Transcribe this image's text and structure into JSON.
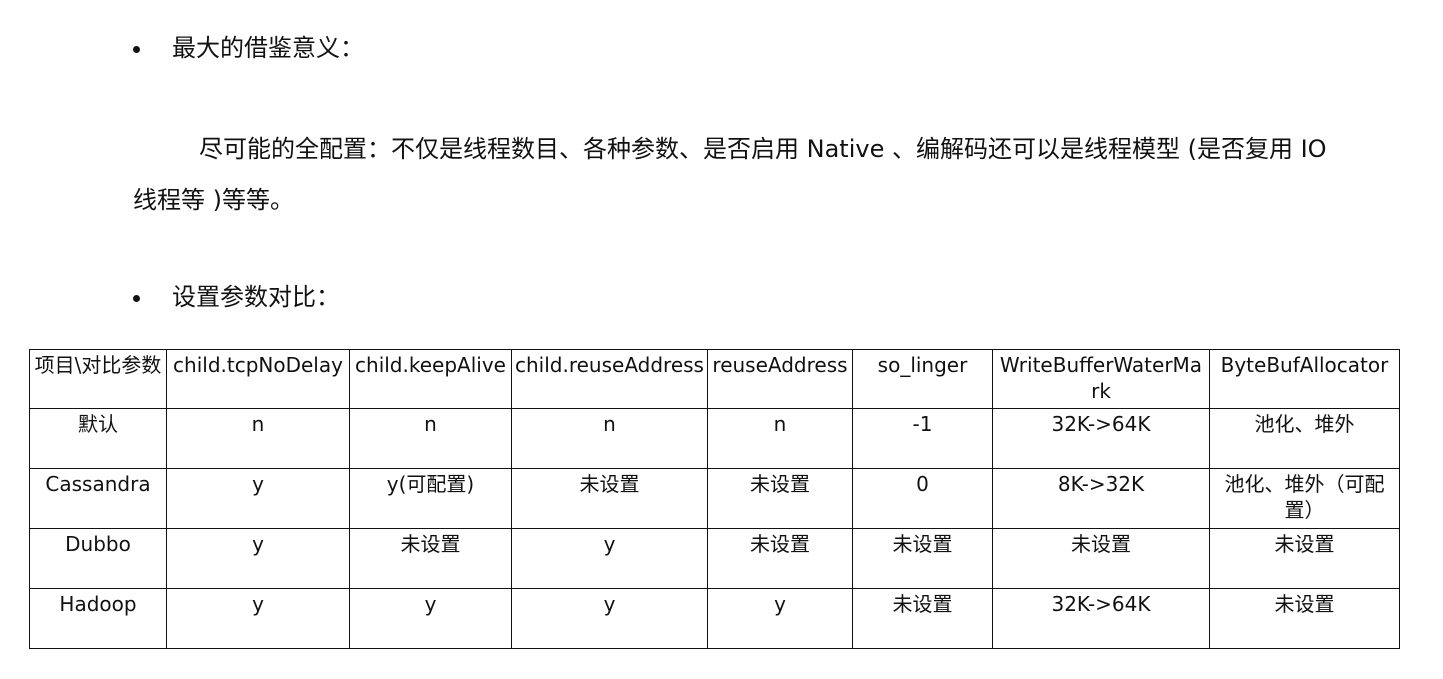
{
  "bullets": [
    "最大的借鉴意义：",
    "设置参数对比："
  ],
  "paragraph": "尽可能的全配置：不仅是线程数目、各种参数、是否启用 Native 、编解码还可以是线程模型 (是否复用 IO 线程等 )等等。",
  "table": {
    "headers": [
      "项目\\对比参数",
      "child.tcpNoDelay",
      "child.keepAlive",
      "child.reuseAddress",
      "reuseAddress",
      "so_linger",
      "WriteBufferWaterMark",
      "ByteBufAllocator"
    ],
    "rows": [
      [
        "默认",
        "n",
        "n",
        "n",
        "n",
        "-1",
        "32K->64K",
        "池化、堆外"
      ],
      [
        "Cassandra",
        "y",
        "y(可配置)",
        "未设置",
        "未设置",
        "0",
        "8K->32K",
        "池化、堆外（可配置）"
      ],
      [
        "Dubbo",
        "y",
        "未设置",
        "y",
        "未设置",
        "未设置",
        "未设置",
        "未设置"
      ],
      [
        "Hadoop",
        "y",
        "y",
        "y",
        "y",
        "未设置",
        "32K->64K",
        "未设置"
      ]
    ]
  }
}
